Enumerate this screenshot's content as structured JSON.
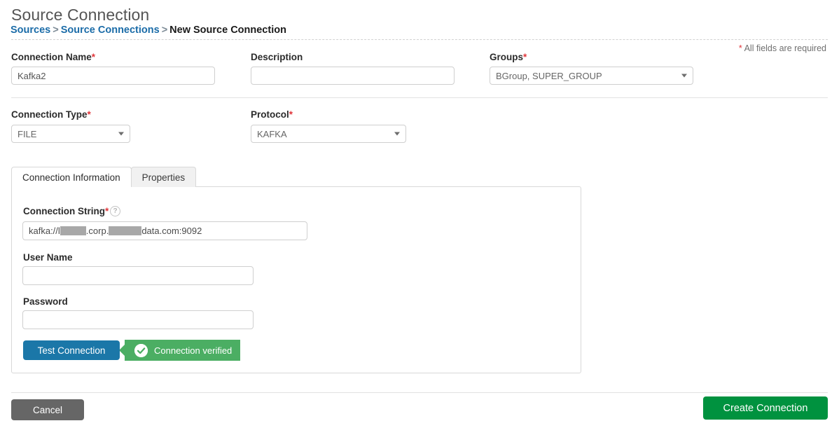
{
  "header": {
    "title": "Source Connection",
    "breadcrumb": {
      "item1": "Sources",
      "sep1": ">",
      "item2": "Source Connections",
      "sep2": ">",
      "current": "New Source Connection"
    }
  },
  "required_note": {
    "asterisk": "*",
    "text": "All fields are required"
  },
  "form": {
    "connection_name": {
      "label": "Connection Name",
      "required_mark": "*",
      "value": "Kafka2",
      "placeholder": ""
    },
    "description": {
      "label": "Description",
      "required_mark": "",
      "value": "",
      "placeholder": ""
    },
    "groups": {
      "label": "Groups",
      "required_mark": "*",
      "value": "BGroup,  SUPER_GROUP",
      "options": [
        "BGroup,  SUPER_GROUP"
      ]
    },
    "connection_type": {
      "label": "Connection Type",
      "required_mark": "*",
      "value": "FILE",
      "options": [
        "FILE"
      ]
    },
    "protocol": {
      "label": "Protocol",
      "required_mark": "*",
      "value": "KAFKA",
      "options": [
        "KAFKA"
      ]
    }
  },
  "tabs": [
    {
      "label": "Connection Information",
      "active": true
    },
    {
      "label": "Properties",
      "active": false
    }
  ],
  "connection_panel": {
    "connection_string": {
      "label": "Connection String",
      "required_mark": "*",
      "help_icon": "question-mark-icon",
      "value_part1": "kafka://l",
      "value_part2": ".corp.",
      "value_part3": "data.com:9092",
      "redacted": true
    },
    "user_name": {
      "label": "User Name",
      "value": "",
      "placeholder": ""
    },
    "password": {
      "label": "Password",
      "value": "",
      "placeholder": ""
    },
    "test_button": {
      "label": "Test Connection"
    },
    "verified_badge": {
      "label": "Connection verified",
      "icon": "check-circle-icon"
    }
  },
  "footer": {
    "cancel_label": "Cancel",
    "create_label": "Create Connection"
  },
  "colors": {
    "link": "#1b6ca8",
    "required_asterisk": "#e0363b",
    "test_button": "#1b77a8",
    "verified_badge": "#4bae63",
    "create_button": "#00923f",
    "cancel_button": "#666666"
  }
}
